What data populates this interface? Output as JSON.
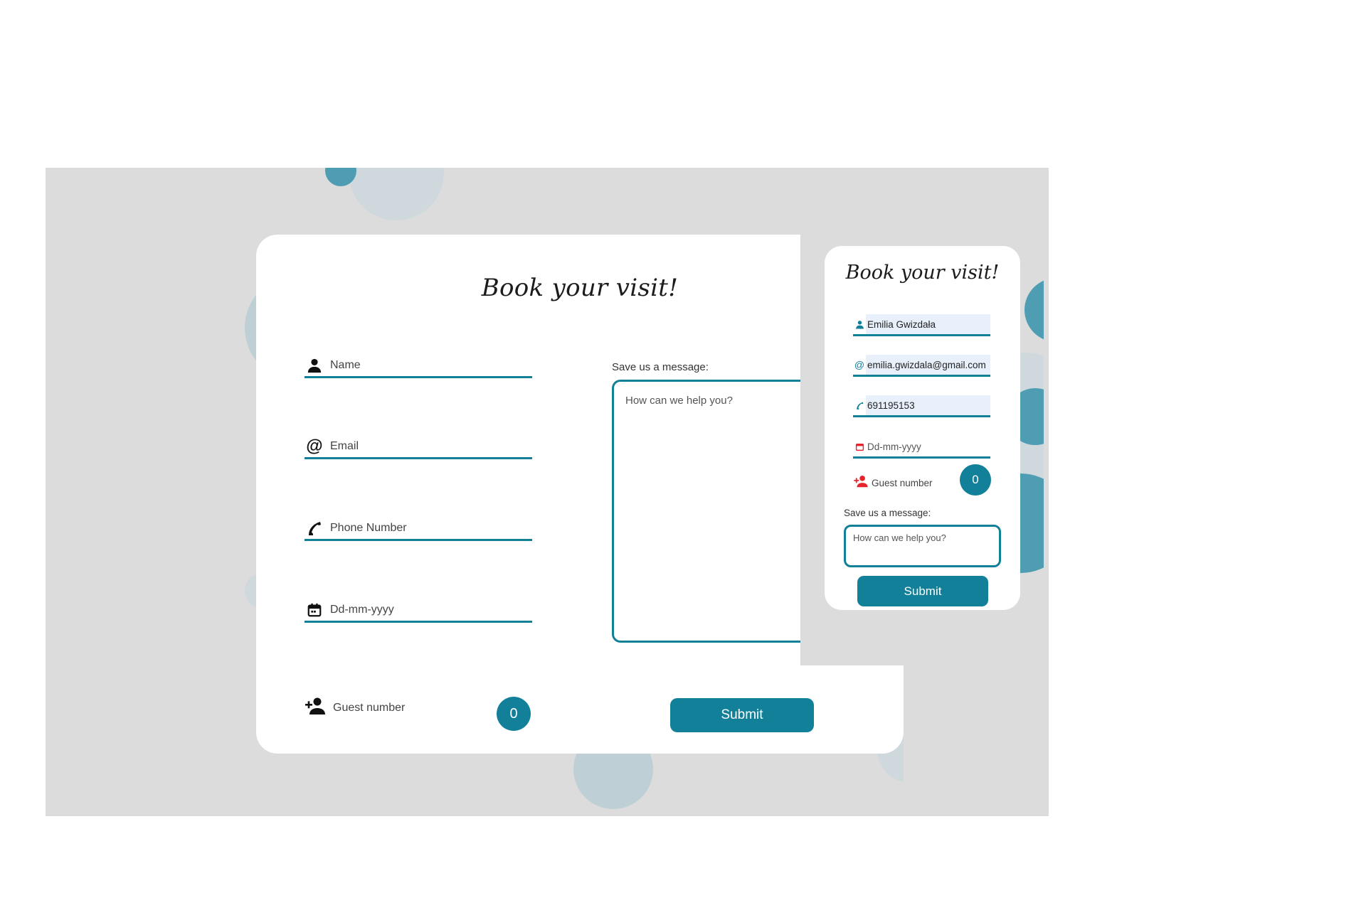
{
  "desktop": {
    "title": "Book your visit!",
    "fields": {
      "name_placeholder": "Name",
      "email_placeholder": "Email",
      "phone_placeholder": "Phone Number",
      "date_placeholder": "Dd-mm-yyyy"
    },
    "message_label": "Save us a message:",
    "message_placeholder": "How can we help you?",
    "guest_label": "Guest number",
    "guest_count": "0",
    "submit_label": "Submit"
  },
  "mobile": {
    "title": "Book your visit!",
    "fields": {
      "name_value": "Emilia Gwizdała",
      "email_value": "emilia.gwizdala@gmail.com",
      "phone_value": "691195153",
      "date_placeholder": "Dd-mm-yyyy"
    },
    "guest_label": "Guest number",
    "guest_count": "0",
    "message_label": "Save us a message:",
    "message_placeholder": "How can we help you?",
    "submit_label": "Submit"
  },
  "colors": {
    "accent": "#13809a",
    "background": "#dcdcdc",
    "icon_red": "#e5242e",
    "autofill": "#e7f0fb"
  },
  "icons": [
    "person-icon",
    "at-icon",
    "phone-icon",
    "calendar-icon",
    "add-person-icon"
  ]
}
